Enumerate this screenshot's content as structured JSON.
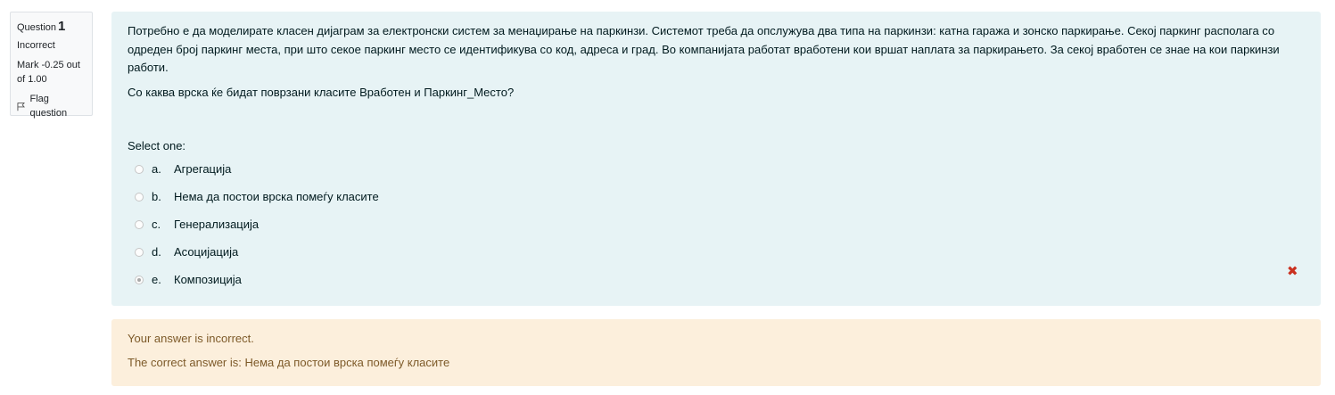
{
  "info": {
    "question_label": "Question",
    "question_number": "1",
    "state": "Incorrect",
    "grade": "Mark -0.25 out of 1.00",
    "flag_label": "Flag question"
  },
  "question": {
    "text_1": "Потребно е да моделирате класен дијаграм за електронски систем за менаџирање на паркинзи. Системот треба да опслужува два типа на паркинзи: катна гаража и зонско паркирање. Секој паркинг располага со одреден број паркинг места, при што секое паркинг место се идентификува со код, адреса и град. Во компанијата работат вработени кои вршат наплата за паркирањето. За секој вработен се знае на кои паркинзи работи.",
    "text_2": "Со каква врска ќе бидат поврзани класите Вработен и Паркинг_Место?",
    "prompt": "Select one:",
    "options": [
      {
        "letter": "a.",
        "label": "Агрегација",
        "selected": false
      },
      {
        "letter": "b.",
        "label": "Нема да постои врска помеѓу класите",
        "selected": false
      },
      {
        "letter": "c.",
        "label": "Генерализација",
        "selected": false
      },
      {
        "letter": "d.",
        "label": "Асоцијација",
        "selected": false
      },
      {
        "letter": "e.",
        "label": "Композиција",
        "selected": true
      }
    ],
    "incorrect_mark": "✖"
  },
  "feedback": {
    "incorrect_text": "Your answer is incorrect.",
    "correct_answer_text": "The correct answer is: Нема да постои врска помеѓу класите"
  },
  "colors": {
    "formulation_bg": "#e7f3f5",
    "feedback_bg": "#fcefdc",
    "feedback_text": "#7d5a29",
    "incorrect_icon": "#ca3120"
  }
}
